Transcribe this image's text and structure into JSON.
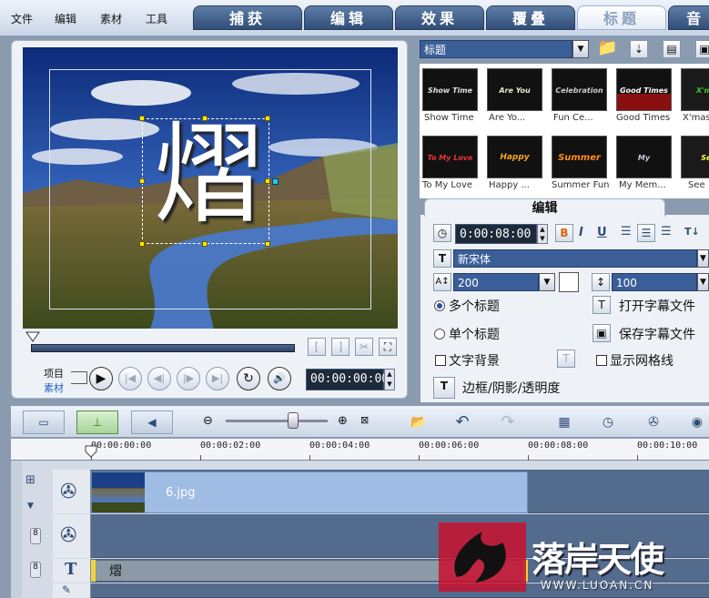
{
  "menu": {
    "file": "文件",
    "edit": "编辑",
    "clip": "素材",
    "tools": "工具"
  },
  "steps": [
    "捕获",
    "编辑",
    "效果",
    "覆叠",
    "标题",
    "音"
  ],
  "active_step": "标题",
  "preview": {
    "title_text": "熠"
  },
  "player": {
    "project_label": "项目",
    "clip_label": "素材",
    "timecode": "00:00:00:00"
  },
  "library": {
    "category": "标题",
    "templates": [
      {
        "label": "Show Time",
        "art": "Show Time"
      },
      {
        "label": "Are Yo...",
        "art": "Are You Ready?"
      },
      {
        "label": "Fun Ce...",
        "art": "Celebration"
      },
      {
        "label": "Good Times",
        "art": "Good Times"
      },
      {
        "label": "X'mas",
        "art": "X'mas"
      },
      {
        "label": "To My Love",
        "art": "To My Love"
      },
      {
        "label": "Happy ...",
        "art": "Happy Halloween"
      },
      {
        "label": "Summer Fun",
        "art": "Summer Fun"
      },
      {
        "label": "My Mem...",
        "art": "My Memories"
      },
      {
        "label": "See",
        "art": "See"
      }
    ]
  },
  "editor": {
    "tab_label": "编辑",
    "duration": "0:00:08:00",
    "bold": "B",
    "italic": "I",
    "underline": "U",
    "vertical_text": "T↓",
    "font": "新宋体",
    "font_size": "200",
    "line_spacing": "100",
    "multi_title": "多个标题",
    "single_title": "单个标题",
    "text_bg": "文字背景",
    "show_grid": "显示网格线",
    "open_subtitle": "打开字幕文件",
    "save_subtitle": "保存字幕文件",
    "border_shadow": "边框/阴影/透明度",
    "multi_selected": true
  },
  "timeline": {
    "time_labels": [
      "00:00:00:00",
      "00:00:02:00",
      "00:00:04:00",
      "00:00:06:00",
      "00:00:08:00",
      "00:00:10:00"
    ],
    "video_clip": "6.jpg",
    "title_clip": "熠"
  },
  "watermark": {
    "brand": "落岸天使",
    "url": "WWW.LUOAN.CN"
  },
  "colors": {
    "accent": "#2f4d77",
    "clip_blue": "#9fbde4",
    "title_clip": "#8c99a7",
    "watermark_red": "#c8102e"
  }
}
